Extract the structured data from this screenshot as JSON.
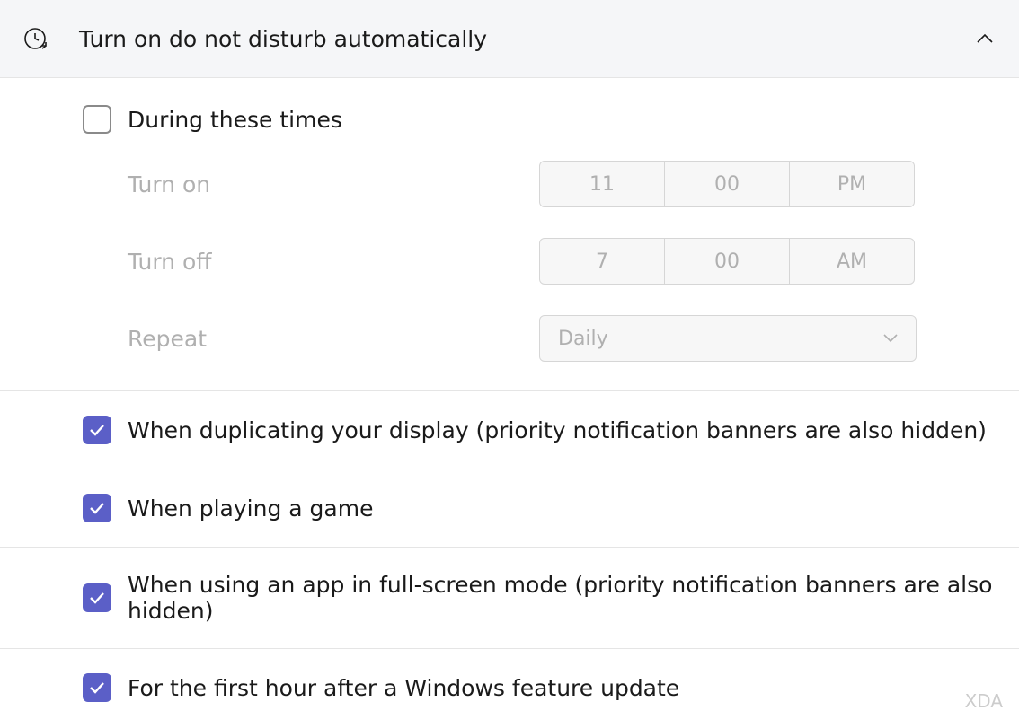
{
  "header": {
    "title": "Turn on do not disturb automatically"
  },
  "times": {
    "during_label": "During these times",
    "turn_on_label": "Turn on",
    "turn_on": {
      "hour": "11",
      "minute": "00",
      "period": "PM"
    },
    "turn_off_label": "Turn off",
    "turn_off": {
      "hour": "7",
      "minute": "00",
      "period": "AM"
    },
    "repeat_label": "Repeat",
    "repeat_value": "Daily"
  },
  "options": [
    {
      "label": "When duplicating your display (priority notification banners are also hidden)",
      "checked": true
    },
    {
      "label": "When playing a game",
      "checked": true
    },
    {
      "label": "When using an app in full-screen mode (priority notification banners are also hidden)",
      "checked": true
    },
    {
      "label": "For the first hour after a Windows feature update",
      "checked": true
    }
  ],
  "watermark": "XDA"
}
